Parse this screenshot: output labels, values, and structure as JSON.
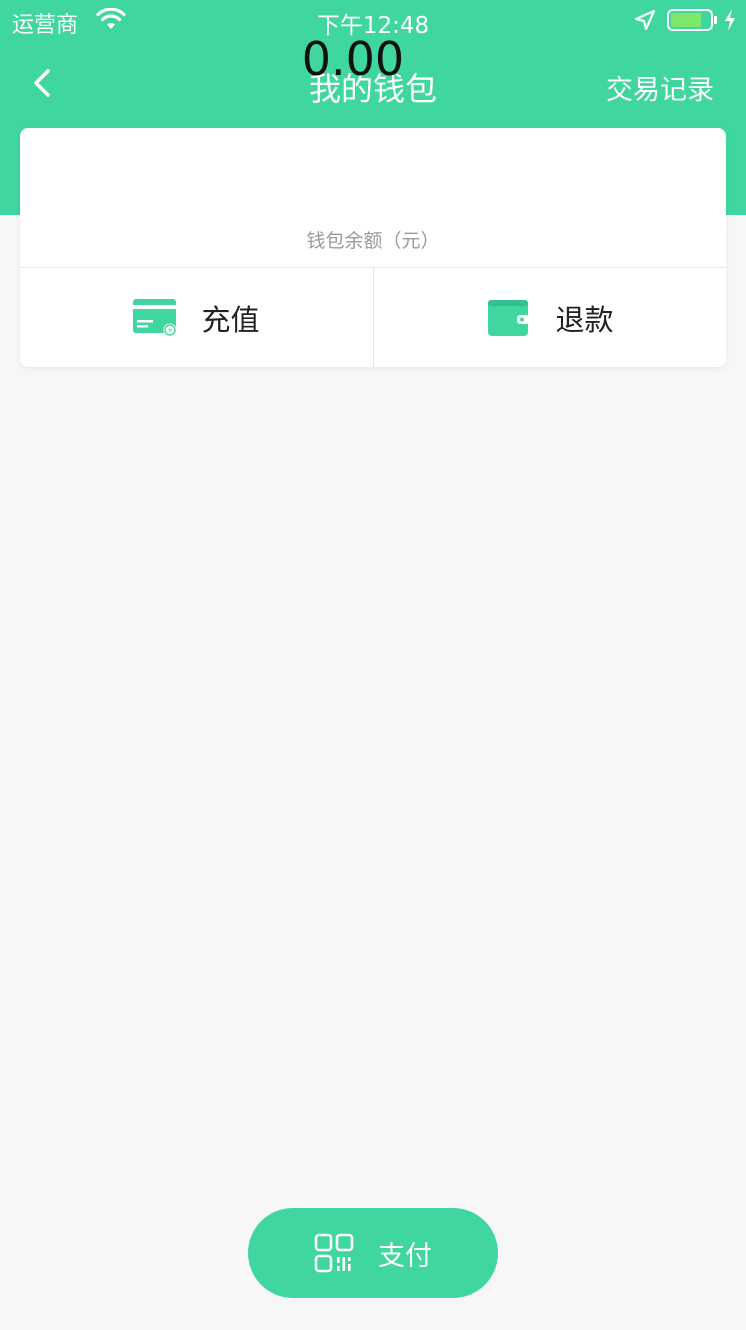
{
  "status_bar": {
    "carrier": "运营商",
    "time": "下午12:48",
    "icons": [
      "wifi-icon",
      "location-icon",
      "battery-icon",
      "charging-icon"
    ]
  },
  "nav": {
    "title": "我的钱包",
    "right_link": "交易记录",
    "back_icon": "chevron-left-icon"
  },
  "wallet": {
    "balance": "0.00",
    "balance_label": "钱包余额（元）",
    "actions": [
      {
        "label": "充值",
        "icon": "card-icon"
      },
      {
        "label": "退款",
        "icon": "wallet-icon"
      }
    ]
  },
  "pay_button": {
    "label": "支付",
    "icon": "qr-code-icon"
  },
  "colors": {
    "brand": "#3fd69f",
    "background": "#f7f7f7",
    "card": "#ffffff"
  }
}
